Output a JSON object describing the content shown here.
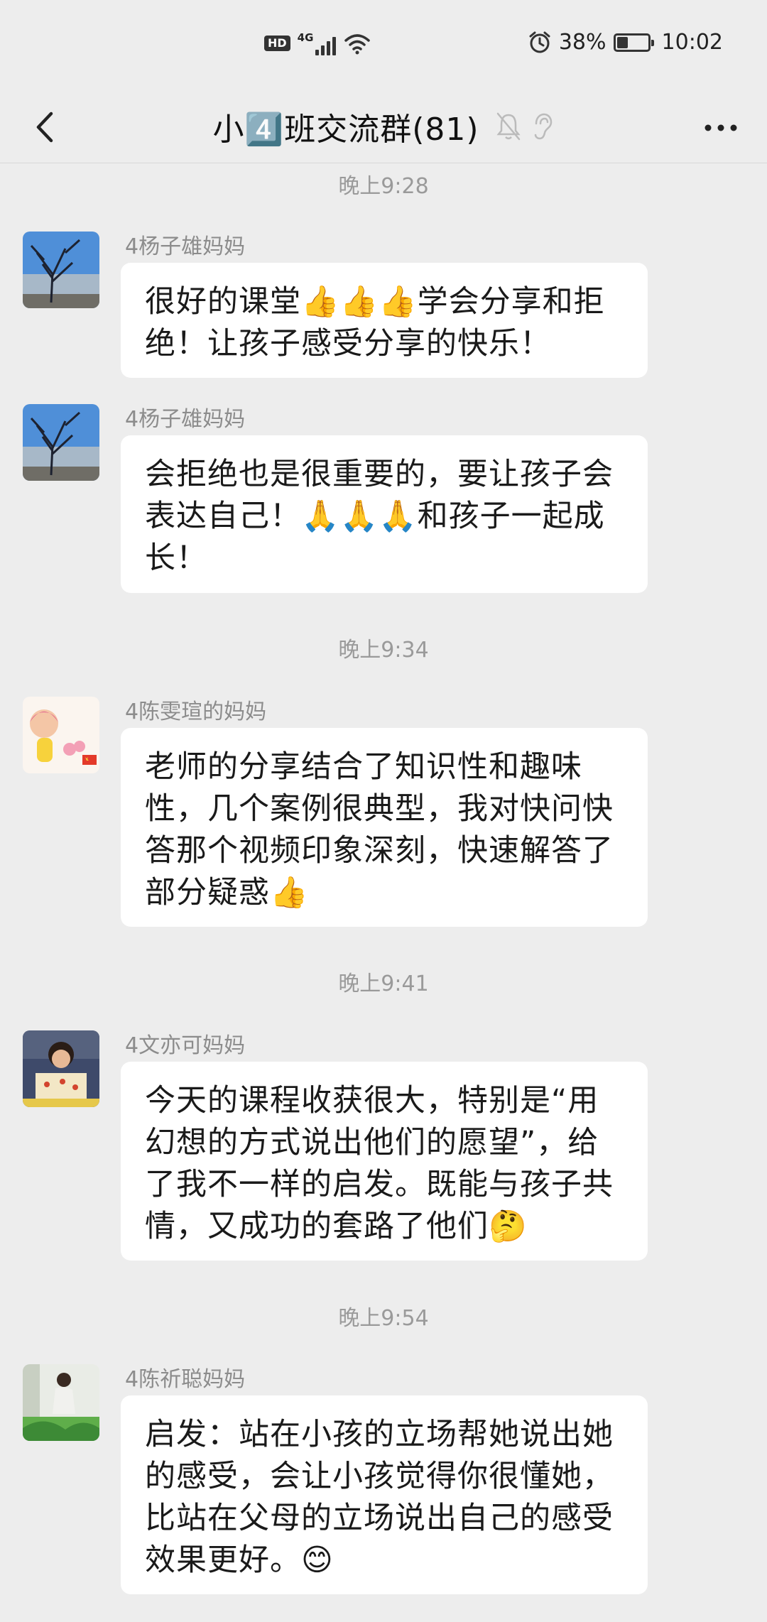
{
  "status_bar": {
    "hd": "HD",
    "network": "4G",
    "battery_percent": "38%",
    "battery_level": 0.38,
    "time": "10:02",
    "icons": [
      "signal-icon",
      "wifi-icon",
      "alarm-icon",
      "battery-icon"
    ]
  },
  "header": {
    "title": "小4️⃣班交流群(81)",
    "icons": [
      "back-icon",
      "mute-bell-icon",
      "ear-icon",
      "more-icon"
    ]
  },
  "messages": [
    {
      "time": "晚上9:28"
    },
    {
      "sender": "4杨子雄妈妈",
      "text": "很好的课堂👍👍👍学会分享和拒绝！让孩子感受分享的快乐！",
      "avatar": "tree-sky-avatar"
    },
    {
      "sender": "4杨子雄妈妈",
      "text": "会拒绝也是很重要的，要让孩子会表达自己！🙏🙏🙏和孩子一起成长！",
      "avatar": "tree-sky-avatar"
    },
    {
      "time": "晚上9:34"
    },
    {
      "sender": "4陈雯瑄的妈妈",
      "text": "老师的分享结合了知识性和趣味性，几个案例很典型，我对快问快答那个视频印象深刻，快速解答了部分疑惑👍",
      "avatar": "cartoon-girl-avatar"
    },
    {
      "time": "晚上9:41"
    },
    {
      "sender": "4文亦可妈妈",
      "text": "今天的课程收获很大，特别是“用幻想的方式说出他们的愿望”，给了我不一样的启发。既能与孩子共情，又成功的套路了他们🤔",
      "avatar": "child-photo-avatar"
    },
    {
      "time": "晚上9:54"
    },
    {
      "sender": "4陈祈聪妈妈",
      "text": "启发：站在小孩的立场帮她说出她的感受，会让小孩觉得你很懂她，比站在父母的立场说出自己的感受效果更好。😊",
      "avatar": "woman-photo-avatar"
    }
  ]
}
